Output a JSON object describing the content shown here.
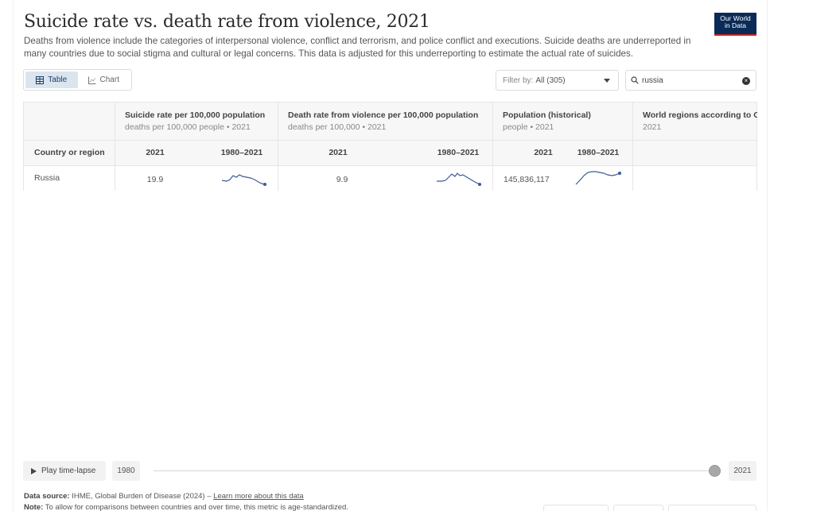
{
  "header": {
    "title": "Suicide rate vs. death rate from violence, 2021",
    "subtitle": "Deaths from violence include the categories of interpersonal violence, conflict and terrorism, and police conflict and executions. Suicide deaths are underreported in many countries due to social stigma and cultural or legal concerns. This data is adjusted for this underreporting to estimate the actual rate of suicides.",
    "logo_line1": "Our World",
    "logo_line2": "in Data"
  },
  "toolbar": {
    "table_label": "Table",
    "chart_label": "Chart",
    "filter_prefix": "Filter by:",
    "filter_value": "All (305)",
    "search_value": "russia"
  },
  "table": {
    "first_col_label": "Country or region",
    "columns": [
      {
        "name": "Suicide rate per 100,000 population",
        "sub": "deaths per 100,000 people • 2021",
        "year_label": "2021",
        "range_label": "1980–2021"
      },
      {
        "name": "Death rate from violence per 100,000 population",
        "sub": "deaths per 100,000 • 2021",
        "year_label": "2021",
        "range_label": "1980–2021"
      },
      {
        "name": "Population (historical)",
        "sub": "people • 2021",
        "year_label": "2021",
        "range_label": "1980–2021"
      },
      {
        "name": "World regions according to OWID",
        "sub": "2021"
      }
    ],
    "rows": [
      {
        "country": "Russia",
        "suicide_2021": "19.9",
        "violence_2021": "9.9",
        "population_2021": "145,836,117"
      }
    ]
  },
  "timeline": {
    "play_label": "Play time-lapse",
    "start_year": "1980",
    "end_year": "2021",
    "position": 1.0
  },
  "footer": {
    "source_label": "Data source:",
    "source_text": "IHME, Global Burden of Disease (2024) –",
    "source_link": "Learn more about this data",
    "note_label": "Note:",
    "note_text": "To allow for comparisons between countries and over time, this metric is age-standardized."
  },
  "colors": {
    "accent": "#3c5a96",
    "logo_bg": "#0a2b57",
    "logo_underline": "#ce261e"
  }
}
